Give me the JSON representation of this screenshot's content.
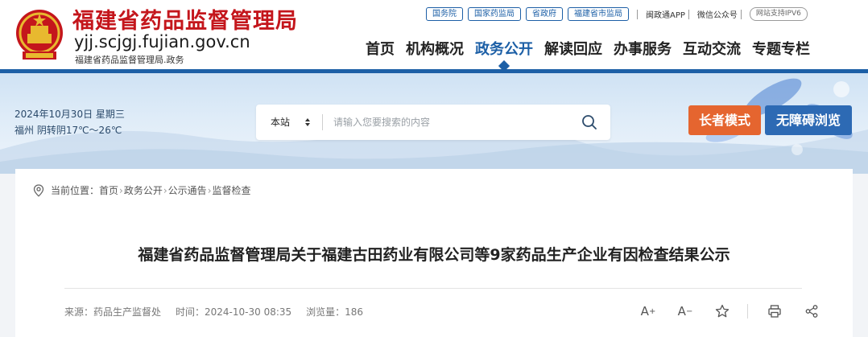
{
  "header": {
    "site_name": "福建省药品监督管理局",
    "domain": "yjj.scjgj.fujian.gov.cn",
    "domain_sub": "福建省药品监督管理局.政务",
    "top_links": [
      "国务院",
      "国家药监局",
      "省政府",
      "福建省市监局"
    ],
    "app_link": "闽政通APP",
    "wechat_link": "微信公众号",
    "ipv6": "网站支持IPV6",
    "nav": [
      {
        "label": "首页",
        "active": false
      },
      {
        "label": "机构概况",
        "active": false
      },
      {
        "label": "政务公开",
        "active": true
      },
      {
        "label": "解读回应",
        "active": false
      },
      {
        "label": "办事服务",
        "active": false
      },
      {
        "label": "互动交流",
        "active": false
      },
      {
        "label": "专题专栏",
        "active": false
      }
    ],
    "accent_color": "#1c5fa6",
    "brand_red": "#c4161c"
  },
  "banner": {
    "date": "2024年10月30日 星期三",
    "weather": "福州 阴转阴17℃～26℃",
    "search_scope": "本站",
    "search_placeholder": "请输入您要搜索的内容",
    "elder_mode": "长者模式",
    "accessible": "无障碍浏览",
    "elder_color": "#e5652f",
    "accessible_color": "#2d6ab4"
  },
  "article": {
    "breadcrumb_label": "当前位置：",
    "breadcrumb": [
      "首页",
      "政务公开",
      "公示通告",
      "监督检查"
    ],
    "title": "福建省药品监督管理局关于福建古田药业有限公司等9家药品生产企业有因检查结果公示",
    "source": "来源：药品生产监督处",
    "time": "时间：2024-10-30 08:35",
    "views": "浏览量：186",
    "tools": {
      "font_increase": "A",
      "font_decrease": "A"
    }
  }
}
